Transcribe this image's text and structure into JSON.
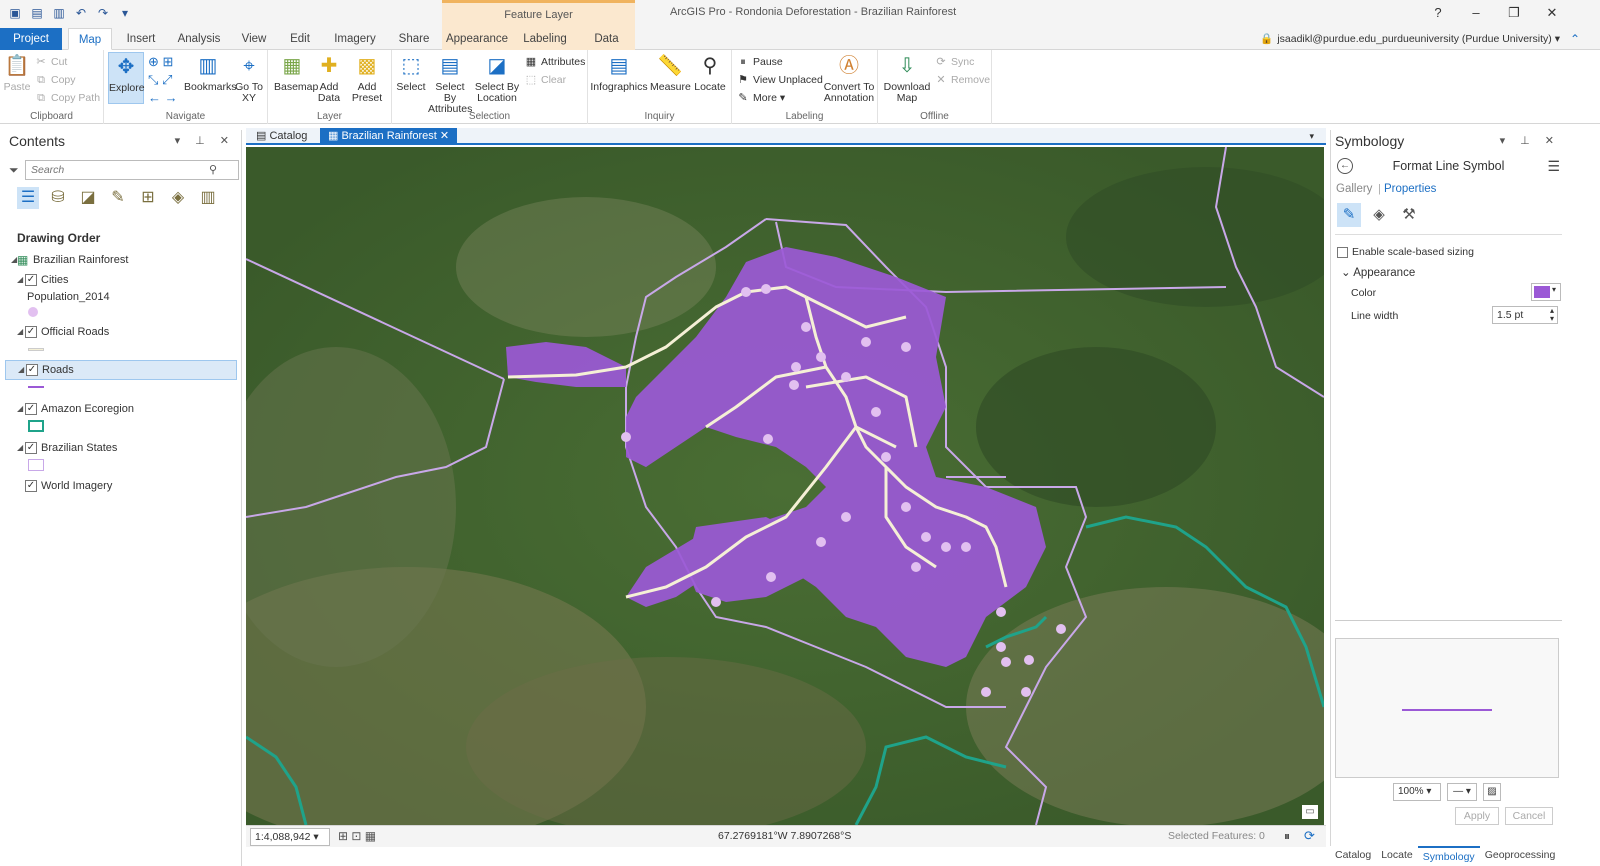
{
  "app": {
    "title": "ArcGIS Pro - Rondonia Deforestation - Brazilian Rainforest",
    "context_tab_group": "Feature Layer",
    "help": "?",
    "user": "jsaadikl@purdue.edu_purdueuniversity (Purdue University)"
  },
  "ribbon_tabs": [
    "Project",
    "Map",
    "Insert",
    "Analysis",
    "View",
    "Edit",
    "Imagery",
    "Share",
    "Appearance",
    "Labeling",
    "Data"
  ],
  "ribbon": {
    "clipboard": {
      "label": "Clipboard",
      "paste": "Paste",
      "cut": "Cut",
      "copy": "Copy",
      "copy_path": "Copy Path"
    },
    "navigate": {
      "label": "Navigate",
      "explore": "Explore",
      "bookmarks": "Bookmarks",
      "goto": "Go To XY"
    },
    "layer": {
      "label": "Layer",
      "basemap": "Basemap",
      "add_data": "Add Data",
      "add_preset": "Add Preset"
    },
    "selection": {
      "label": "Selection",
      "select": "Select",
      "by_attr": "Select By Attributes",
      "by_loc": "Select By Location",
      "attributes": "Attributes",
      "clear": "Clear"
    },
    "inquiry": {
      "label": "Inquiry",
      "infographics": "Infographics",
      "measure": "Measure",
      "locate": "Locate"
    },
    "labeling": {
      "label": "Labeling",
      "pause": "Pause",
      "view_unplaced": "View Unplaced",
      "more": "More",
      "convert": "Convert To Annotation"
    },
    "offline": {
      "label": "Offline",
      "download": "Download Map",
      "sync": "Sync",
      "remove": "Remove"
    }
  },
  "contents": {
    "title": "Contents",
    "search_placeholder": "Search",
    "drawing_order": "Drawing Order",
    "map_name": "Brazilian Rainforest",
    "layers": [
      {
        "name": "Cities",
        "sub": "Population_2014"
      },
      {
        "name": "Official Roads"
      },
      {
        "name": "Roads"
      },
      {
        "name": "Amazon Ecoregion"
      },
      {
        "name": "Brazilian States"
      },
      {
        "name": "World Imagery"
      }
    ]
  },
  "view_tabs": [
    "Catalog",
    "Brazilian Rainforest"
  ],
  "status": {
    "scale": "1:4,088,942",
    "coords": "67.2769181°W 7.8907268°S",
    "selected": "Selected Features: 0"
  },
  "symbology": {
    "title": "Symbology",
    "heading": "Format Line Symbol",
    "gallery": "Gallery",
    "properties": "Properties",
    "scale_sizing": "Enable scale-based sizing",
    "appearance": "Appearance",
    "color_label": "Color",
    "color": "#9b59d6",
    "line_width_label": "Line width",
    "line_width": "1.5 pt",
    "zoom": "100%",
    "apply": "Apply",
    "cancel": "Cancel"
  },
  "bottom_tabs": [
    "Catalog",
    "Locate",
    "Symbology",
    "Geoprocessing"
  ],
  "colors": {
    "accent": "#1c6fc4",
    "roads": "#9b59d6",
    "official_roads": "#f5f0d6",
    "ecoregion": "#1fa38a",
    "states": "#c8a8e8",
    "cities": "#e2c0f0"
  }
}
